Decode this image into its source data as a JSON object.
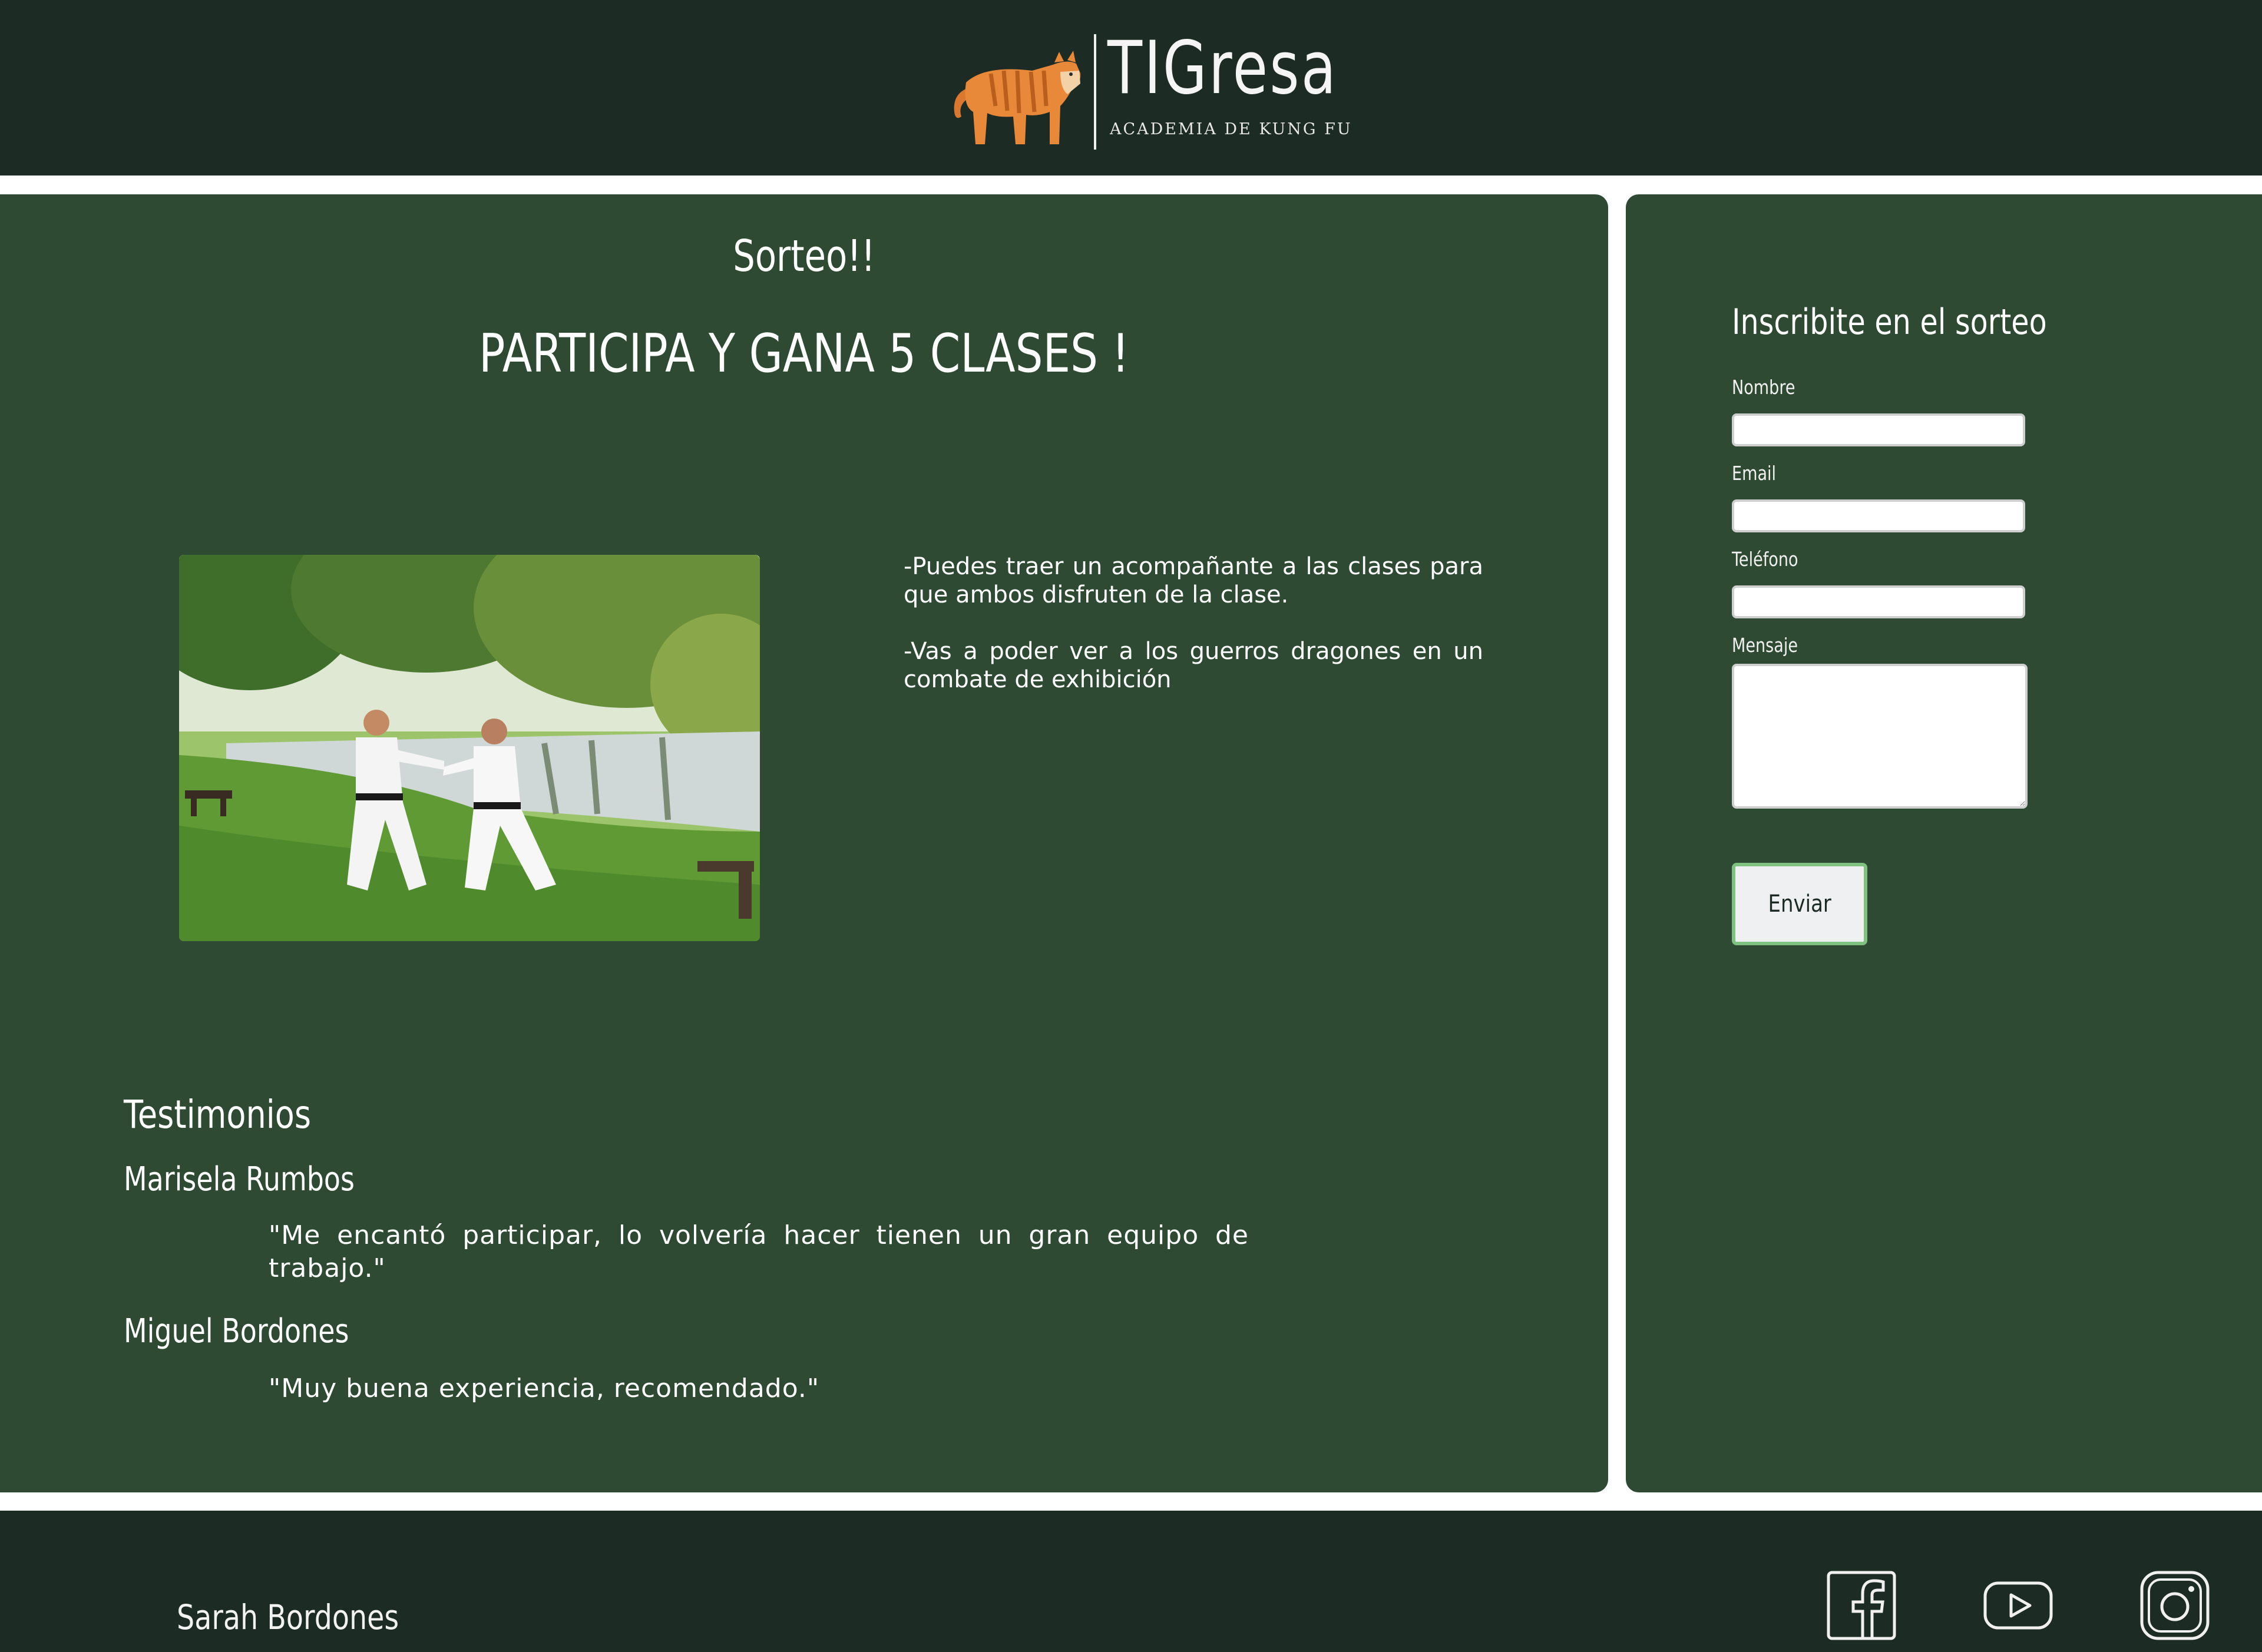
{
  "header": {
    "logo_name": "TIGresa",
    "logo_subtitle": "ACADEMIA DE KUNG FU"
  },
  "promo": {
    "title": "Sorteo!!",
    "headline": "PARTICIPA Y GANA 5 CLASES !",
    "benefits": [
      "-Puedes traer un acompañante a las clases para que ambos disfruten de la clase.",
      "-Vas a poder ver a los guerros dragones en un combate de exhibición"
    ]
  },
  "testimonials": {
    "heading": "Testimonios",
    "items": [
      {
        "name": "Marisela Rumbos",
        "quote": "\"Me encantó participar, lo volvería hacer tienen un gran equipo de trabajo.\""
      },
      {
        "name": "Miguel Bordones",
        "quote": "\"Muy buena experiencia, recomendado.\""
      }
    ]
  },
  "form": {
    "title": "Inscribite en el sorteo",
    "labels": {
      "name": "Nombre",
      "email": "Email",
      "phone": "Teléfono",
      "message": "Mensaje"
    },
    "values": {
      "name": "",
      "email": "",
      "phone": "",
      "message": ""
    },
    "submit_label": "Enviar"
  },
  "footer": {
    "name": "Sarah Bordones",
    "social_icons": [
      "facebook-icon",
      "youtube-icon",
      "instagram-icon"
    ]
  },
  "colors": {
    "header_bg": "#1c2b24",
    "panel_bg": "#2e4a32",
    "button_border": "#7fc17f",
    "tiger_orange": "#e8893a"
  }
}
